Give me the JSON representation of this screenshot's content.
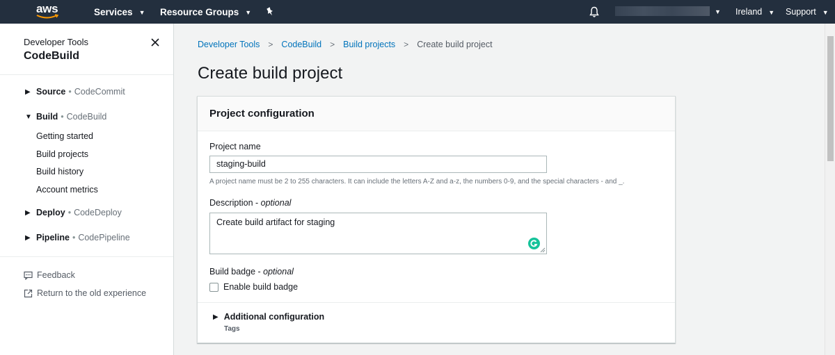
{
  "topnav": {
    "logo_text": "aws",
    "services_label": "Services",
    "resource_groups_label": "Resource Groups",
    "region_label": "Ireland",
    "support_label": "Support"
  },
  "sidebar": {
    "eyebrow": "Developer Tools",
    "title": "CodeBuild",
    "sections": [
      {
        "main": "Source",
        "sub": "CodeCommit"
      },
      {
        "main": "Build",
        "sub": "CodeBuild"
      },
      {
        "main": "Deploy",
        "sub": "CodeDeploy"
      },
      {
        "main": "Pipeline",
        "sub": "CodePipeline"
      }
    ],
    "build_links": [
      "Getting started",
      "Build projects",
      "Build history",
      "Account metrics"
    ],
    "feedback_label": "Feedback",
    "old_experience_label": "Return to the old experience"
  },
  "breadcrumb": {
    "items": [
      "Developer Tools",
      "CodeBuild",
      "Build projects"
    ],
    "current": "Create build project"
  },
  "page": {
    "title": "Create build project"
  },
  "project_config": {
    "title": "Project configuration",
    "name_label": "Project name",
    "name_value": "staging-build",
    "name_hint": "A project name must be 2 to 255 characters. It can include the letters A-Z and a-z, the numbers 0-9, and the special characters - and _.",
    "description_label": "Description",
    "description_optional": "optional",
    "description_value": "Create build artifact for staging",
    "badge_label": "Build badge",
    "badge_optional": "optional",
    "badge_checkbox_label": "Enable build badge",
    "badge_checked": false,
    "additional_label": "Additional configuration",
    "additional_sub": "Tags"
  },
  "colors": {
    "nav_bg": "#232f3e",
    "link": "#0073bb",
    "page_bg": "#f2f3f3",
    "grammarly": "#15c39a"
  }
}
